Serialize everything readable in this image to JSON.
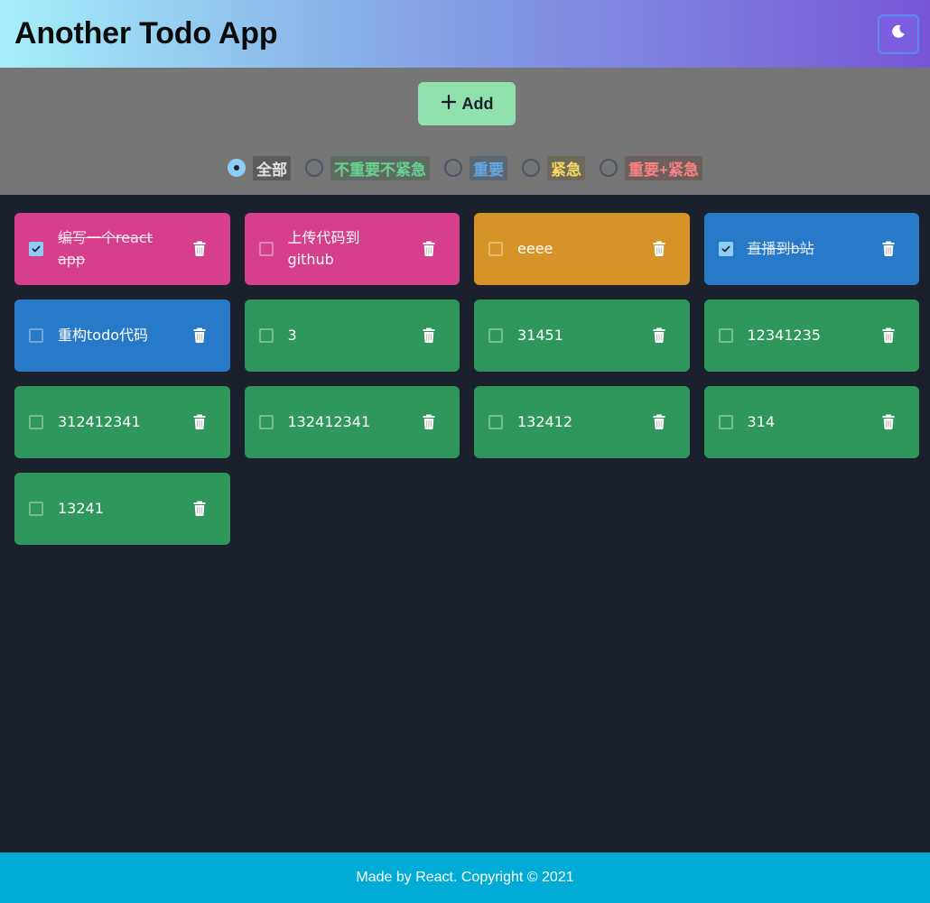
{
  "app": {
    "title": "Another Todo App"
  },
  "header": {
    "theme_toggle_icon": "moon-icon"
  },
  "toolbar": {
    "add_label": "Add",
    "add_icon": "plus-icon"
  },
  "filters": [
    {
      "label": "全部",
      "checked": true,
      "color": "#e2e2e2",
      "bg": "#5b5b5b"
    },
    {
      "label": "不重要不紧急",
      "checked": false,
      "color": "#68d391",
      "bg": "#5e6c63"
    },
    {
      "label": "重要",
      "checked": false,
      "color": "#63a8e6",
      "bg": "#5d6872"
    },
    {
      "label": "紧急",
      "checked": false,
      "color": "#f6d860",
      "bg": "#6d6a5c"
    },
    {
      "label": "重要+紧急",
      "checked": false,
      "color": "#fc8181",
      "bg": "#6e5f5f"
    }
  ],
  "colors": {
    "important_urgent": "#d53f8c",
    "urgent": "#d69328",
    "important": "#2979c9",
    "none": "#2f975b"
  },
  "todos": [
    {
      "text": "编写一个react app",
      "done": true,
      "category": "important_urgent"
    },
    {
      "text": "上传代码到github",
      "done": false,
      "category": "important_urgent"
    },
    {
      "text": "eeee",
      "done": false,
      "category": "urgent"
    },
    {
      "text": "直播到b站",
      "done": true,
      "category": "important"
    },
    {
      "text": "重构todo代码",
      "done": false,
      "category": "important"
    },
    {
      "text": "3",
      "done": false,
      "category": "none"
    },
    {
      "text": "31451",
      "done": false,
      "category": "none"
    },
    {
      "text": "12341235",
      "done": false,
      "category": "none"
    },
    {
      "text": "312412341",
      "done": false,
      "category": "none"
    },
    {
      "text": "132412341",
      "done": false,
      "category": "none"
    },
    {
      "text": "132412",
      "done": false,
      "category": "none"
    },
    {
      "text": "314",
      "done": false,
      "category": "none"
    },
    {
      "text": "13241",
      "done": false,
      "category": "none"
    }
  ],
  "footer": {
    "text": "Made by React. Copyright © 2021"
  }
}
